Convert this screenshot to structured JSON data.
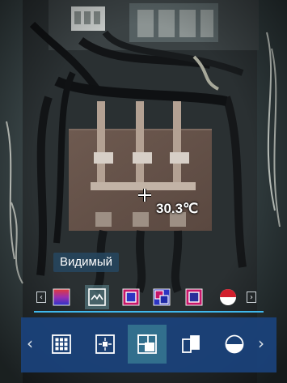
{
  "measurement": {
    "center_temperature": "30.3℃"
  },
  "palette_bar": {
    "label": "Видимый",
    "items": [
      {
        "icon": "rainbow-palette-icon",
        "selected": false
      },
      {
        "icon": "visible-image-icon",
        "selected": true
      },
      {
        "icon": "box-palette-icon",
        "selected": false
      },
      {
        "icon": "overlap-palette-icon",
        "selected": false
      },
      {
        "icon": "frame-palette-icon",
        "selected": false
      },
      {
        "icon": "half-circle-palette-icon",
        "selected": false
      }
    ]
  },
  "display_mode_bar": {
    "items": [
      {
        "icon": "grid-icon",
        "selected": false
      },
      {
        "icon": "center-point-icon",
        "selected": false
      },
      {
        "icon": "picture-in-picture-icon",
        "selected": true
      },
      {
        "icon": "split-view-icon",
        "selected": false
      },
      {
        "icon": "half-fill-circle-icon",
        "selected": false
      }
    ]
  },
  "colors": {
    "accent": "#3fb8ee",
    "bar_background": "#1b427a",
    "selected_highlight": "#4b96a0",
    "panel_plate": "#6a5448"
  }
}
